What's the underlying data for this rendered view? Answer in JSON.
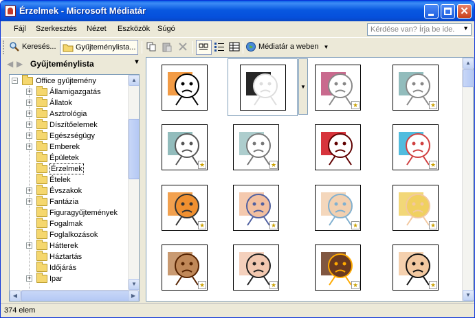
{
  "window": {
    "title": "Érzelmek - Microsoft Médiatár"
  },
  "menubar": {
    "items": [
      {
        "label": "Fájl"
      },
      {
        "label": "Szerkesztés"
      },
      {
        "label": "Nézet"
      },
      {
        "label": "Eszközök"
      },
      {
        "label": "Súgó"
      }
    ],
    "help_placeholder": "Kérdése van? Írja be ide."
  },
  "toolbar": {
    "search_label": "Keresés...",
    "collections_label": "Gyűjteménylista...",
    "web_label": "Médiatár a weben"
  },
  "left_pane": {
    "title": "Gyűjteménylista",
    "root": "Office gyűjtemény",
    "items": [
      {
        "label": "Államigazgatás",
        "expandable": true
      },
      {
        "label": "Állatok",
        "expandable": true
      },
      {
        "label": "Asztrológia",
        "expandable": true
      },
      {
        "label": "Díszítőelemek",
        "expandable": true
      },
      {
        "label": "Egészségügy",
        "expandable": true
      },
      {
        "label": "Emberek",
        "expandable": true
      },
      {
        "label": "Épületek",
        "expandable": false
      },
      {
        "label": "Érzelmek",
        "expandable": false,
        "selected": true
      },
      {
        "label": "Ételek",
        "expandable": false
      },
      {
        "label": "Évszakok",
        "expandable": true
      },
      {
        "label": "Fantázia",
        "expandable": true
      },
      {
        "label": "Figuragyűjtemények",
        "expandable": false
      },
      {
        "label": "Fogalmak",
        "expandable": false
      },
      {
        "label": "Foglalkozások",
        "expandable": false
      },
      {
        "label": "Hátterek",
        "expandable": true
      },
      {
        "label": "Háztartás",
        "expandable": false
      },
      {
        "label": "Időjárás",
        "expandable": false
      },
      {
        "label": "Ipar",
        "expandable": true
      }
    ]
  },
  "gallery": {
    "clips": [
      {
        "name": "scared-ball-clip",
        "colors": [
          "#f08a24",
          "#000000"
        ]
      },
      {
        "name": "silhouette-arms-up-clip",
        "colors": [
          "#000000",
          "#dddddd"
        ]
      },
      {
        "name": "cupid-clip",
        "colors": [
          "#c0507a",
          "#888888"
        ]
      },
      {
        "name": "gray-figures-clip",
        "colors": [
          "#7fb0b0",
          "#888888"
        ]
      },
      {
        "name": "teal-sketch-man-clip",
        "colors": [
          "#7fb0b0",
          "#555555"
        ]
      },
      {
        "name": "teal-sketch-scene-clip",
        "colors": [
          "#9fc4c4",
          "#777777"
        ]
      },
      {
        "name": "red-heart-clip",
        "colors": [
          "#d0101a",
          "#600000"
        ]
      },
      {
        "name": "car-crash-clip",
        "colors": [
          "#33b0d8",
          "#d04040"
        ]
      },
      {
        "name": "stressed-desk-clip",
        "colors": [
          "#f09030",
          "#333333"
        ]
      },
      {
        "name": "bald-face-clip",
        "colors": [
          "#f2c0a0",
          "#5060a0"
        ]
      },
      {
        "name": "sick-old-man-clip",
        "colors": [
          "#f2d0b0",
          "#80b0d0"
        ]
      },
      {
        "name": "blonde-woman-clip",
        "colors": [
          "#f0d060",
          "#f2c8a0"
        ]
      },
      {
        "name": "worried-man-clip",
        "colors": [
          "#c08858",
          "#552200"
        ]
      },
      {
        "name": "hair-standing-clip",
        "colors": [
          "#f2c8b0",
          "#222222"
        ]
      },
      {
        "name": "sad-dark-man-clip",
        "colors": [
          "#6a3a20",
          "#ffaa00"
        ]
      },
      {
        "name": "frowning-man-clip",
        "colors": [
          "#f2c8a0",
          "#111111"
        ]
      }
    ]
  },
  "status": {
    "text": "374 elem"
  }
}
